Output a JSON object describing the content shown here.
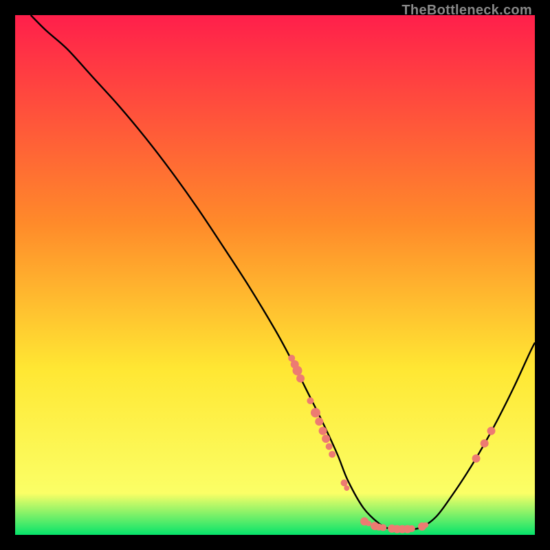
{
  "watermark": "TheBottleneck.com",
  "colors": {
    "gradient_top": "#ff1f4b",
    "gradient_mid1": "#ff8a2a",
    "gradient_mid2": "#ffe733",
    "gradient_mid3": "#fbff66",
    "gradient_bottom": "#06e36b",
    "curve": "#000000",
    "markers": "#ed7b72",
    "frame": "#000000"
  },
  "chart_data": {
    "type": "line",
    "title": "",
    "xlabel": "",
    "ylabel": "",
    "xlim": [
      0,
      100
    ],
    "ylim": [
      0,
      100
    ],
    "curve": {
      "name": "bottleneck-curve",
      "x": [
        3,
        6,
        10,
        15,
        20,
        25,
        30,
        35,
        40,
        45,
        50,
        53,
        56,
        59,
        62,
        64,
        67,
        70,
        72,
        75,
        78,
        81,
        84,
        87,
        90,
        93,
        96,
        99,
        100
      ],
      "y": [
        100,
        97,
        93.5,
        88,
        82.5,
        76.5,
        70,
        63,
        55.5,
        47.8,
        39.5,
        34,
        28,
        22,
        15.5,
        10.5,
        5.2,
        2.2,
        1.2,
        1.0,
        1.4,
        3.5,
        7.5,
        12,
        17,
        22.5,
        28.5,
        35,
        37
      ]
    },
    "markers": {
      "name": "gpu-markers",
      "points": [
        {
          "x": 53.2,
          "y": 34.0,
          "r": 5
        },
        {
          "x": 53.8,
          "y": 32.8,
          "r": 6
        },
        {
          "x": 54.3,
          "y": 31.6,
          "r": 7
        },
        {
          "x": 54.9,
          "y": 30.1,
          "r": 6
        },
        {
          "x": 56.8,
          "y": 25.8,
          "r": 5
        },
        {
          "x": 57.8,
          "y": 23.5,
          "r": 7
        },
        {
          "x": 58.5,
          "y": 21.8,
          "r": 6
        },
        {
          "x": 59.2,
          "y": 20.0,
          "r": 6
        },
        {
          "x": 59.8,
          "y": 18.5,
          "r": 6
        },
        {
          "x": 60.4,
          "y": 17.0,
          "r": 5
        },
        {
          "x": 61.0,
          "y": 15.5,
          "r": 5
        },
        {
          "x": 63.3,
          "y": 10.0,
          "r": 5
        },
        {
          "x": 63.8,
          "y": 9.0,
          "r": 4
        },
        {
          "x": 67.2,
          "y": 2.6,
          "r": 6
        },
        {
          "x": 68.0,
          "y": 2.2,
          "r": 4
        },
        {
          "x": 69.2,
          "y": 1.7,
          "r": 6
        },
        {
          "x": 70.0,
          "y": 1.5,
          "r": 5
        },
        {
          "x": 70.8,
          "y": 1.4,
          "r": 5
        },
        {
          "x": 72.5,
          "y": 1.2,
          "r": 6
        },
        {
          "x": 73.5,
          "y": 1.1,
          "r": 6
        },
        {
          "x": 74.5,
          "y": 1.1,
          "r": 6
        },
        {
          "x": 75.5,
          "y": 1.1,
          "r": 6
        },
        {
          "x": 76.3,
          "y": 1.2,
          "r": 5
        },
        {
          "x": 78.3,
          "y": 1.6,
          "r": 6
        },
        {
          "x": 79.0,
          "y": 1.9,
          "r": 4
        },
        {
          "x": 88.7,
          "y": 14.7,
          "r": 6
        },
        {
          "x": 90.3,
          "y": 17.6,
          "r": 6
        },
        {
          "x": 91.6,
          "y": 20.0,
          "r": 6
        }
      ]
    }
  }
}
